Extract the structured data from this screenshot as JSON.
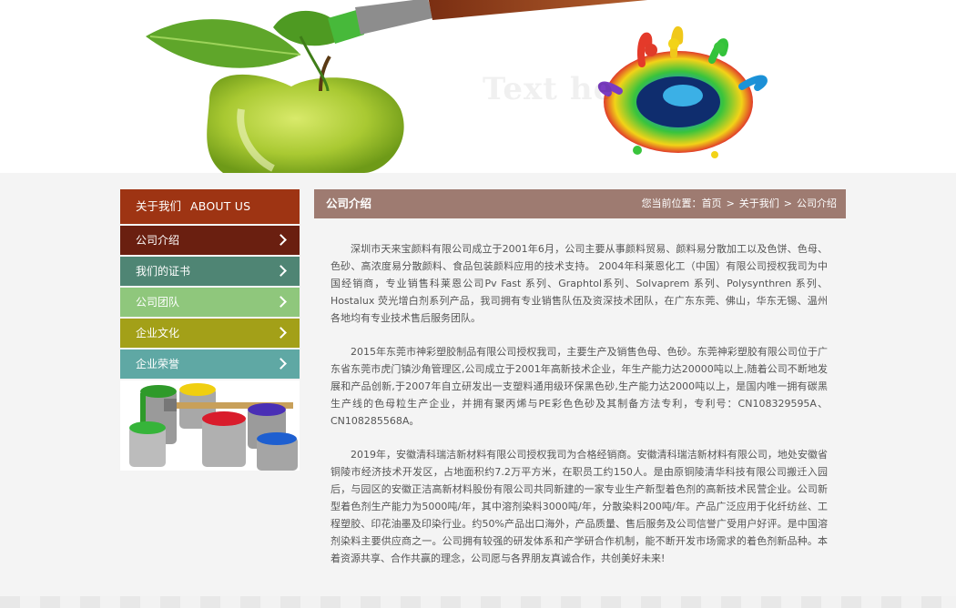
{
  "sidebar": {
    "header_cn": "关于我们",
    "header_en": "ABOUT US",
    "items": [
      {
        "label": "公司介绍",
        "color": "#6a1f10"
      },
      {
        "label": "我们的证书",
        "color": "#4f8574"
      },
      {
        "label": "公司团队",
        "color": "#8fc77c"
      },
      {
        "label": "企业文化",
        "color": "#a3a018"
      },
      {
        "label": "企业荣誉",
        "color": "#5fa8a4"
      }
    ]
  },
  "main": {
    "title": "公司介绍",
    "breadcrumb": {
      "prefix": "您当前位置：",
      "home": "首页",
      "level1": "关于我们",
      "level2": "公司介绍",
      "separator": ">"
    },
    "paragraphs": [
      "深圳市天来宝颜料有限公司成立于2001年6月，公司主要从事颜料贸易、颜料易分散加工以及色饼、色母、色砂、高浓度易分散颜料、食品包装颜料应用的技术支持。 2004年科莱恩化工（中国）有限公司授权我司为中国经销商，专业销售科莱恩公司Pv Fast 系列、Graphtol系列、Solvaprem 系列、Polysynthren 系列、Hostalux 荧光增白剂系列产品，我司拥有专业销售队伍及资深技术团队，在广东东莞、佛山，华东无锡、温州各地均有专业技术售后服务团队。",
      "2015年东莞市神彩塑胶制品有限公司授权我司，主要生产及销售色母、色砂。东莞神彩塑胶有限公司位于广东省东莞市虎门镇沙角管理区,公司成立于2001年高新技术企业，年生产能力达20000吨以上,随着公司不断地发展和产品创新,于2007年自立研发出一支塑料通用级环保黑色砂,生产能力达2000吨以上，是国内唯一拥有碳黑生产线的色母粒生产企业，并拥有聚丙烯与PE彩色色砂及其制备方法专利，专利号：CN108329595A、CN108285568A。",
      "2019年，安徽清科瑞洁新材料有限公司授权我司为合格经销商。安徽清科瑞洁新材料有限公司，地处安徽省铜陵市经济技术开发区，占地面积约7.2万平方米，在职员工约150人。是由原铜陵清华科技有限公司搬迁入园后，与园区的安徽正洁高新材料股份有限公司共同新建的一家专业生产新型着色剂的高新技术民营企业。公司新型着色剂生产能力为5000吨/年，其中溶剂染料3000吨/年，分散染料200吨/年。产品广泛应用于化纤纺丝、工程塑胶、印花油墨及印染行业。约50%产品出口海外，产品质量、售后服务及公司信誉广受用户好评。是中国溶剂染料主要供应商之一。公司拥有较强的研发体系和产学研合作机制，能不断开发市场需求的着色剂新品种。本着资源共享、合作共赢的理念，公司愿与各界朋友真诚合作，共创美好未来!"
    ]
  },
  "banner": {
    "ghost_text": "Text he"
  }
}
